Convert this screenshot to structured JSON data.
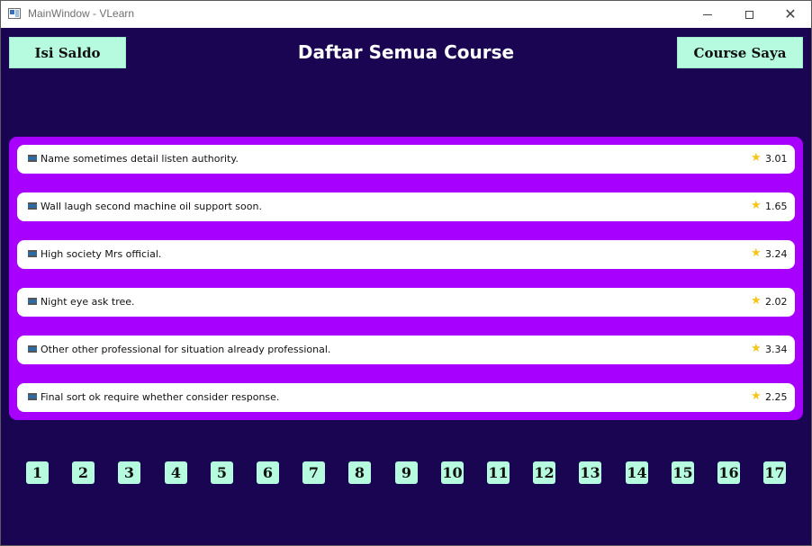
{
  "window": {
    "title": "MainWindow - VLearn",
    "minimize_glyph": "",
    "close_glyph": "✕"
  },
  "header": {
    "left_button": "Isi Saldo",
    "title": "Daftar Semua Course",
    "right_button": "Course Saya"
  },
  "courses": [
    {
      "title": "Name sometimes detail listen authority.",
      "rating": "3.01"
    },
    {
      "title": "Wall laugh second machine oil support soon.",
      "rating": "1.65"
    },
    {
      "title": "High society Mrs official.",
      "rating": "3.24"
    },
    {
      "title": "Night eye ask tree.",
      "rating": "2.02"
    },
    {
      "title": "Other other professional for situation already professional.",
      "rating": "3.34"
    },
    {
      "title": "Final sort ok require whether consider response.",
      "rating": "2.25"
    }
  ],
  "pagination": [
    "1",
    "2",
    "3",
    "4",
    "5",
    "6",
    "7",
    "8",
    "9",
    "10",
    "11",
    "12",
    "13",
    "14",
    "15",
    "16",
    "17"
  ],
  "colors": {
    "background": "#1a0552",
    "panel": "#a800ff",
    "button": "#b6fbe0",
    "star": "#f5c518"
  },
  "icons": {
    "course": "film-icon",
    "rating": "star-icon",
    "app": "window-icon"
  }
}
